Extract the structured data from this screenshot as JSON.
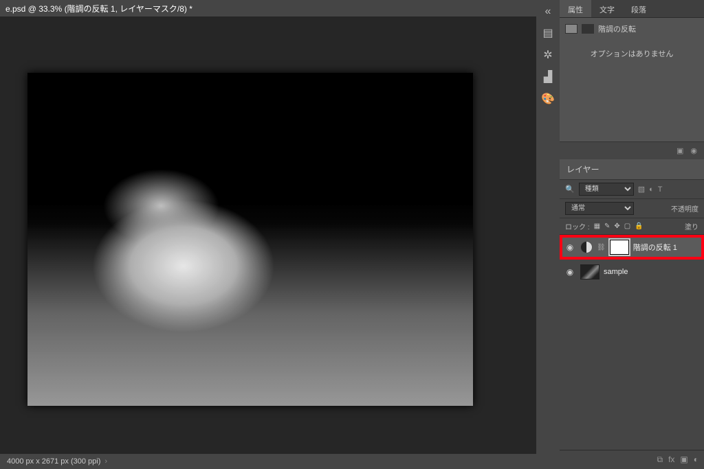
{
  "document_tab": "e.psd @ 33.3% (階調の反転 1, レイヤーマスク/8) *",
  "status_bar": "4000 px x 2671 px (300 ppi)",
  "tool_dock": {
    "items": [
      "adjust-icon",
      "3d-icon",
      "settings-icon",
      "color-icon"
    ]
  },
  "properties_panel": {
    "tabs": [
      "属性",
      "文字",
      "段落"
    ],
    "active_tab": "属性",
    "adjustment_label": "階調の反転",
    "no_options_message": "オプションはありません"
  },
  "layers_panel": {
    "title": "レイヤー",
    "filter_label": "種類",
    "blend_mode": "通常",
    "opacity_label": "不透明度",
    "lock_label": "ロック :",
    "fill_label": "塗り",
    "layers": [
      {
        "name": "階調の反転 1",
        "type": "adjustment",
        "visible": true,
        "highlighted": true
      },
      {
        "name": "sample",
        "type": "image",
        "visible": true,
        "highlighted": false
      }
    ]
  },
  "icons": {
    "eye": "◉",
    "link": "⛓",
    "search": "🔍",
    "image": "▧",
    "circle": "◐",
    "text": "T",
    "fx": "fx",
    "mask": "▣",
    "folder": "▭",
    "trash": "▯",
    "chain": "⧉",
    "reset": "↺"
  }
}
